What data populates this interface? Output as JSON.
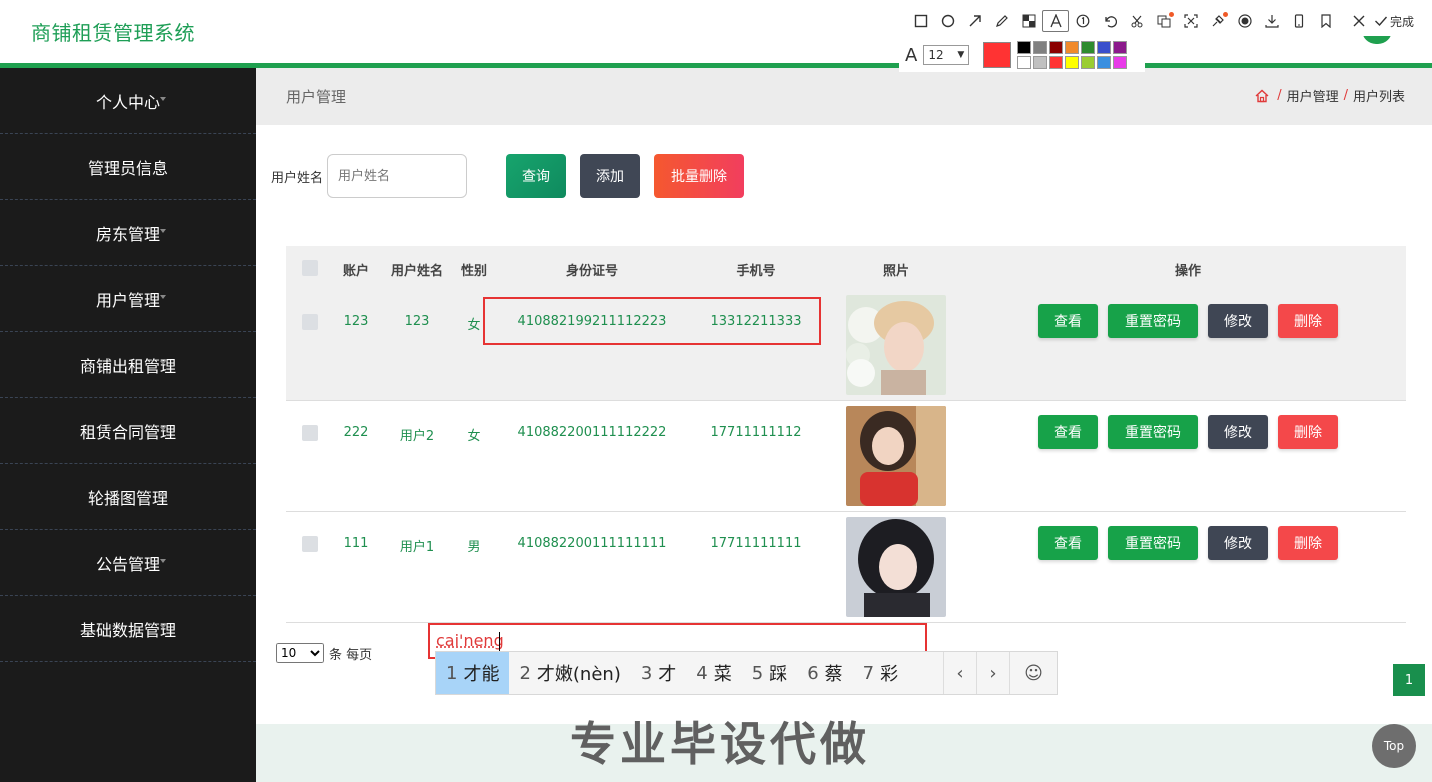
{
  "app": {
    "title": "商铺租赁管理系统"
  },
  "sidebar": {
    "items": [
      {
        "label": "个人中心"
      },
      {
        "label": "管理员信息"
      },
      {
        "label": "房东管理"
      },
      {
        "label": "用户管理"
      },
      {
        "label": "商铺出租管理"
      },
      {
        "label": "租赁合同管理"
      },
      {
        "label": "轮播图管理"
      },
      {
        "label": "公告管理"
      },
      {
        "label": "基础数据管理"
      }
    ]
  },
  "page": {
    "title": "用户管理",
    "breadcrumb": [
      "用户管理",
      "用户列表"
    ]
  },
  "search": {
    "label": "用户姓名",
    "placeholder": "用户姓名",
    "query_label": "查询",
    "add_label": "添加",
    "batch_delete_label": "批量删除"
  },
  "table": {
    "headers": {
      "account": "账户",
      "name": "用户姓名",
      "gender": "性别",
      "id_card": "身份证号",
      "phone": "手机号",
      "photo": "照片",
      "actions": "操作"
    },
    "rows": [
      {
        "account": "123",
        "name": "123",
        "gender": "女",
        "id_card": "410882199211112223",
        "phone": "13312211333"
      },
      {
        "account": "222",
        "name": "用户2",
        "gender": "女",
        "id_card": "410882200111112222",
        "phone": "17711111112"
      },
      {
        "account": "111",
        "name": "用户1",
        "gender": "男",
        "id_card": "410882200111111111",
        "phone": "17711111111"
      }
    ],
    "actions": {
      "view": "查看",
      "reset": "重置密码",
      "edit": "修改",
      "delete": "删除"
    }
  },
  "pagination": {
    "page_size": "10",
    "per_page_label": "条 每页",
    "current_page": "1"
  },
  "ime": {
    "composition": "cai'neng",
    "candidates": [
      {
        "n": "1",
        "text": "才能"
      },
      {
        "n": "2",
        "text": "才嫩(nèn)"
      },
      {
        "n": "3",
        "text": "才"
      },
      {
        "n": "4",
        "text": "菜"
      },
      {
        "n": "5",
        "text": "踩"
      },
      {
        "n": "6",
        "text": "蔡"
      },
      {
        "n": "7",
        "text": "彩"
      }
    ],
    "prev": "‹",
    "next": "›",
    "emoji": "☺"
  },
  "screenshot_toolbar": {
    "done_label": "完成",
    "font_size": "12",
    "font_glyph": "A"
  },
  "watermark": "专业毕设代做",
  "top_button": "Top",
  "colors": {
    "brand": "#1fa04f",
    "sidebar_bg": "#1b1b1b",
    "danger": "#f4484a",
    "highlight_box": "#e63333"
  }
}
